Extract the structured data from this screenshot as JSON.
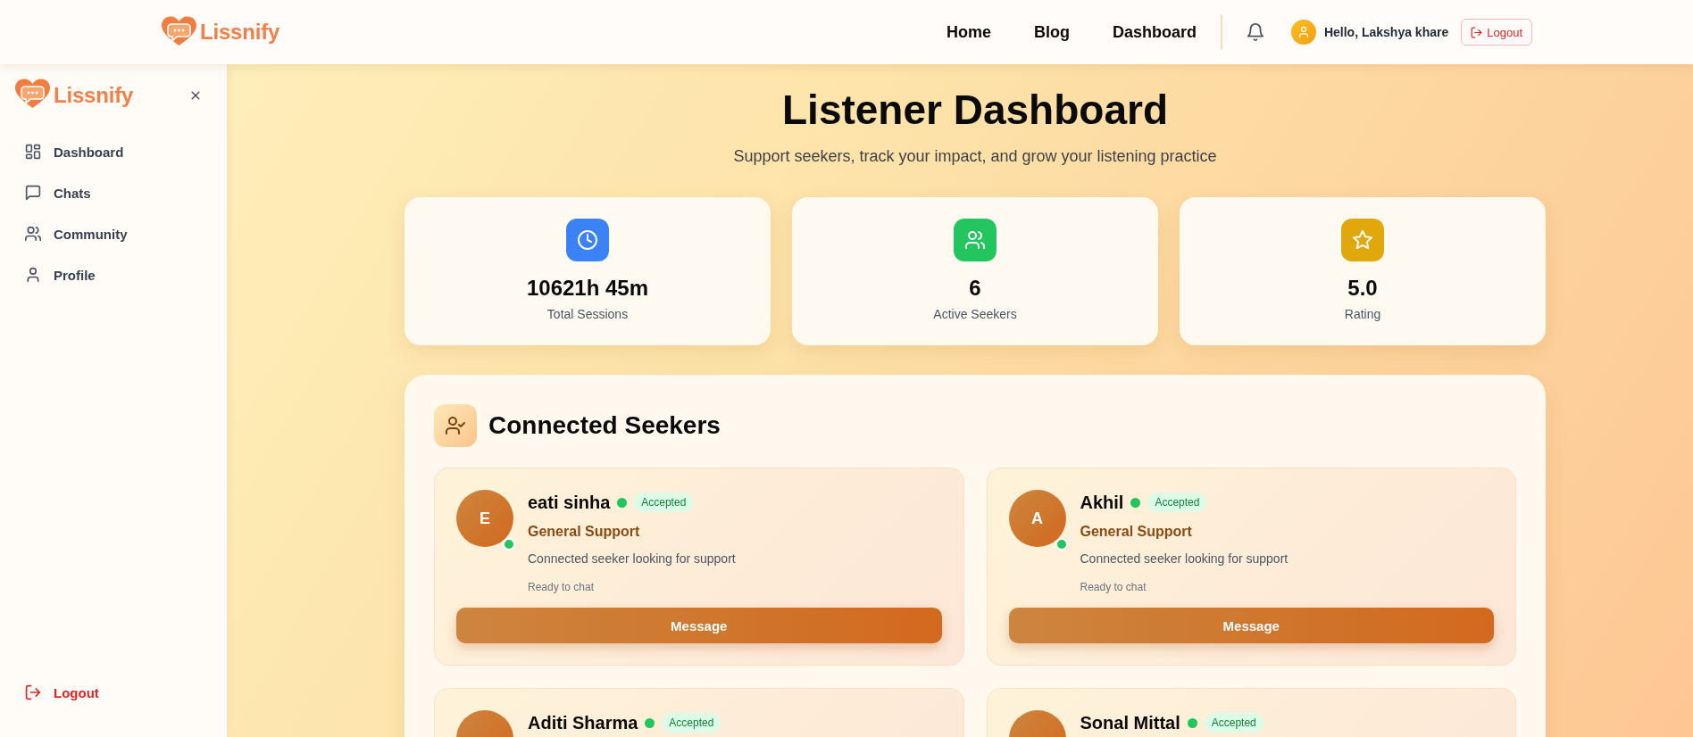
{
  "header": {
    "brand": "Lissnify",
    "nav": [
      "Home",
      "Blog",
      "Dashboard"
    ],
    "greeting": "Hello, Lakshya khare",
    "logout": "Logout"
  },
  "sidebar": {
    "brand": "Lissnify",
    "items": [
      "Dashboard",
      "Chats",
      "Community",
      "Profile"
    ],
    "logout": "Logout"
  },
  "page": {
    "title": "Listener Dashboard",
    "subtitle": "Support seekers, track your impact, and grow your listening practice"
  },
  "stats": [
    {
      "value": "10621h 45m",
      "label": "Total Sessions",
      "color": "#3b82f6"
    },
    {
      "value": "6",
      "label": "Active Seekers",
      "color": "#22c55e"
    },
    {
      "value": "5.0",
      "label": "Rating",
      "color": "#e0a80a"
    }
  ],
  "seekers_panel": {
    "title": "Connected Seekers",
    "seekers": [
      {
        "initial": "E",
        "name": "eati sinha",
        "online": true,
        "status": "Accepted",
        "topic": "General Support",
        "description": "Connected seeker looking for support",
        "note": "Ready to chat",
        "action": "Message"
      },
      {
        "initial": "A",
        "name": "Akhil",
        "online": true,
        "status": "Accepted",
        "topic": "General Support",
        "description": "Connected seeker looking for support",
        "note": "Ready to chat",
        "action": "Message"
      },
      {
        "name": "Aditi Sharma",
        "online": true,
        "status": "Accepted"
      },
      {
        "name": "Sonal Mittal",
        "online": true,
        "status": "Accepted"
      }
    ]
  }
}
